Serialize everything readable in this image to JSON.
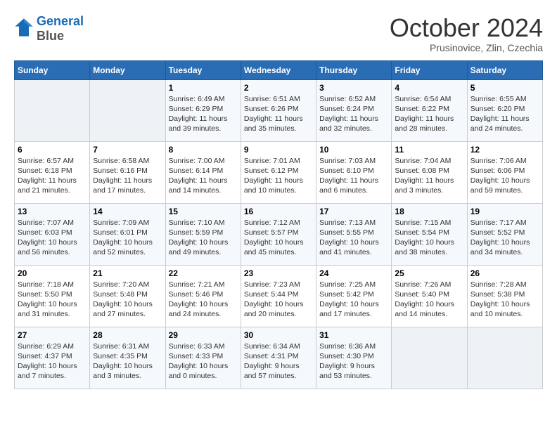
{
  "header": {
    "logo_line1": "General",
    "logo_line2": "Blue",
    "month": "October 2024",
    "location": "Prusinovice, Zlin, Czechia"
  },
  "weekdays": [
    "Sunday",
    "Monday",
    "Tuesday",
    "Wednesday",
    "Thursday",
    "Friday",
    "Saturday"
  ],
  "weeks": [
    [
      {
        "day": "",
        "info": ""
      },
      {
        "day": "",
        "info": ""
      },
      {
        "day": "1",
        "info": "Sunrise: 6:49 AM\nSunset: 6:29 PM\nDaylight: 11 hours and 39 minutes."
      },
      {
        "day": "2",
        "info": "Sunrise: 6:51 AM\nSunset: 6:26 PM\nDaylight: 11 hours and 35 minutes."
      },
      {
        "day": "3",
        "info": "Sunrise: 6:52 AM\nSunset: 6:24 PM\nDaylight: 11 hours and 32 minutes."
      },
      {
        "day": "4",
        "info": "Sunrise: 6:54 AM\nSunset: 6:22 PM\nDaylight: 11 hours and 28 minutes."
      },
      {
        "day": "5",
        "info": "Sunrise: 6:55 AM\nSunset: 6:20 PM\nDaylight: 11 hours and 24 minutes."
      }
    ],
    [
      {
        "day": "6",
        "info": "Sunrise: 6:57 AM\nSunset: 6:18 PM\nDaylight: 11 hours and 21 minutes."
      },
      {
        "day": "7",
        "info": "Sunrise: 6:58 AM\nSunset: 6:16 PM\nDaylight: 11 hours and 17 minutes."
      },
      {
        "day": "8",
        "info": "Sunrise: 7:00 AM\nSunset: 6:14 PM\nDaylight: 11 hours and 14 minutes."
      },
      {
        "day": "9",
        "info": "Sunrise: 7:01 AM\nSunset: 6:12 PM\nDaylight: 11 hours and 10 minutes."
      },
      {
        "day": "10",
        "info": "Sunrise: 7:03 AM\nSunset: 6:10 PM\nDaylight: 11 hours and 6 minutes."
      },
      {
        "day": "11",
        "info": "Sunrise: 7:04 AM\nSunset: 6:08 PM\nDaylight: 11 hours and 3 minutes."
      },
      {
        "day": "12",
        "info": "Sunrise: 7:06 AM\nSunset: 6:06 PM\nDaylight: 10 hours and 59 minutes."
      }
    ],
    [
      {
        "day": "13",
        "info": "Sunrise: 7:07 AM\nSunset: 6:03 PM\nDaylight: 10 hours and 56 minutes."
      },
      {
        "day": "14",
        "info": "Sunrise: 7:09 AM\nSunset: 6:01 PM\nDaylight: 10 hours and 52 minutes."
      },
      {
        "day": "15",
        "info": "Sunrise: 7:10 AM\nSunset: 5:59 PM\nDaylight: 10 hours and 49 minutes."
      },
      {
        "day": "16",
        "info": "Sunrise: 7:12 AM\nSunset: 5:57 PM\nDaylight: 10 hours and 45 minutes."
      },
      {
        "day": "17",
        "info": "Sunrise: 7:13 AM\nSunset: 5:55 PM\nDaylight: 10 hours and 41 minutes."
      },
      {
        "day": "18",
        "info": "Sunrise: 7:15 AM\nSunset: 5:54 PM\nDaylight: 10 hours and 38 minutes."
      },
      {
        "day": "19",
        "info": "Sunrise: 7:17 AM\nSunset: 5:52 PM\nDaylight: 10 hours and 34 minutes."
      }
    ],
    [
      {
        "day": "20",
        "info": "Sunrise: 7:18 AM\nSunset: 5:50 PM\nDaylight: 10 hours and 31 minutes."
      },
      {
        "day": "21",
        "info": "Sunrise: 7:20 AM\nSunset: 5:48 PM\nDaylight: 10 hours and 27 minutes."
      },
      {
        "day": "22",
        "info": "Sunrise: 7:21 AM\nSunset: 5:46 PM\nDaylight: 10 hours and 24 minutes."
      },
      {
        "day": "23",
        "info": "Sunrise: 7:23 AM\nSunset: 5:44 PM\nDaylight: 10 hours and 20 minutes."
      },
      {
        "day": "24",
        "info": "Sunrise: 7:25 AM\nSunset: 5:42 PM\nDaylight: 10 hours and 17 minutes."
      },
      {
        "day": "25",
        "info": "Sunrise: 7:26 AM\nSunset: 5:40 PM\nDaylight: 10 hours and 14 minutes."
      },
      {
        "day": "26",
        "info": "Sunrise: 7:28 AM\nSunset: 5:38 PM\nDaylight: 10 hours and 10 minutes."
      }
    ],
    [
      {
        "day": "27",
        "info": "Sunrise: 6:29 AM\nSunset: 4:37 PM\nDaylight: 10 hours and 7 minutes."
      },
      {
        "day": "28",
        "info": "Sunrise: 6:31 AM\nSunset: 4:35 PM\nDaylight: 10 hours and 3 minutes."
      },
      {
        "day": "29",
        "info": "Sunrise: 6:33 AM\nSunset: 4:33 PM\nDaylight: 10 hours and 0 minutes."
      },
      {
        "day": "30",
        "info": "Sunrise: 6:34 AM\nSunset: 4:31 PM\nDaylight: 9 hours and 57 minutes."
      },
      {
        "day": "31",
        "info": "Sunrise: 6:36 AM\nSunset: 4:30 PM\nDaylight: 9 hours and 53 minutes."
      },
      {
        "day": "",
        "info": ""
      },
      {
        "day": "",
        "info": ""
      }
    ]
  ]
}
